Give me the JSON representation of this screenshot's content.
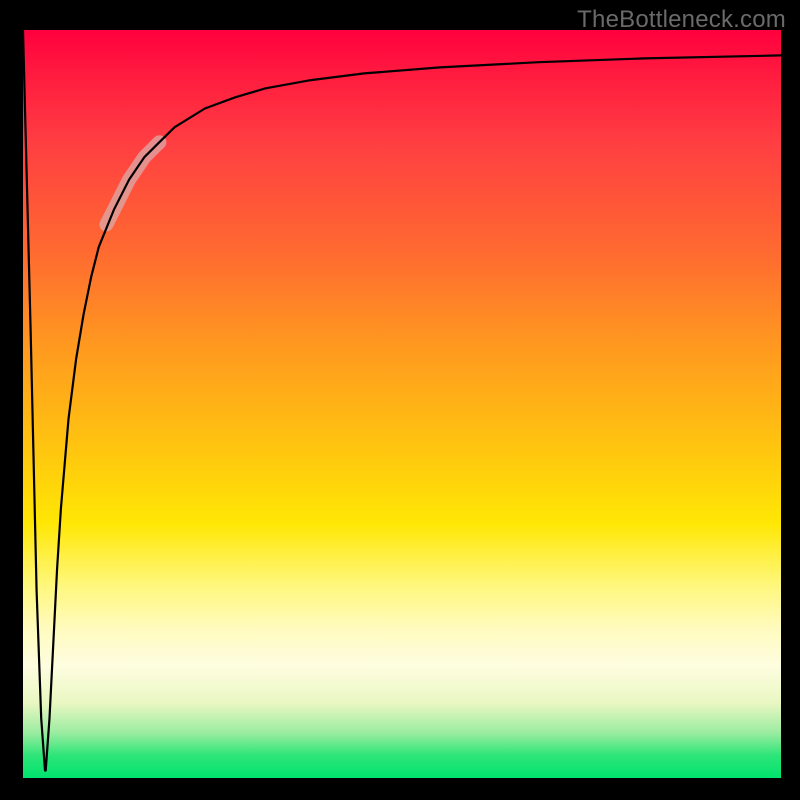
{
  "watermark": "TheBottleneck.com",
  "chart_data": {
    "type": "line",
    "title": "",
    "xlabel": "",
    "ylabel": "",
    "x_range": [
      0,
      100
    ],
    "y_range": [
      0,
      100
    ],
    "grid": false,
    "legend": false,
    "background_gradient_meaning": "vertical color scale red(top)→green(bottom); implied bottleneck severity (red≈100% bad, green≈0% good)",
    "gradient_stops": [
      {
        "pos": 0.0,
        "color": "#ff003e"
      },
      {
        "pos": 0.3,
        "color": "#ff6b30"
      },
      {
        "pos": 0.55,
        "color": "#ffc210"
      },
      {
        "pos": 0.74,
        "color": "#fff77a"
      },
      {
        "pos": 0.97,
        "color": "#2de578"
      },
      {
        "pos": 1.0,
        "color": "#00e36e"
      }
    ],
    "series": [
      {
        "name": "bottleneck-curve",
        "color": "#000000",
        "stroke_width": 2,
        "x": [
          0,
          1.0,
          1.8,
          2.4,
          2.9,
          3.0,
          3.5,
          4.0,
          4.5,
          5.0,
          5.5,
          6.0,
          7.0,
          8.0,
          9.0,
          10,
          12,
          14,
          16,
          18,
          20,
          24,
          28,
          32,
          38,
          45,
          55,
          68,
          82,
          100
        ],
        "y": [
          100,
          60,
          25,
          8,
          1,
          1,
          8,
          18,
          28,
          36,
          42,
          48,
          56,
          62,
          67,
          71,
          76,
          80,
          83,
          85,
          87,
          89.5,
          91,
          92.2,
          93.3,
          94.2,
          95,
          95.7,
          96.2,
          96.6
        ]
      },
      {
        "name": "highlight-band",
        "note": "thicker translucent segment on the rising part of the curve (~x 11–18)",
        "color": "rgba(255,255,255,0.35)",
        "stroke_width": 14,
        "x": [
          11,
          12,
          13,
          14,
          15,
          16,
          17,
          18
        ],
        "y": [
          74,
          76,
          78,
          80,
          81.5,
          83,
          84,
          85
        ]
      }
    ]
  }
}
